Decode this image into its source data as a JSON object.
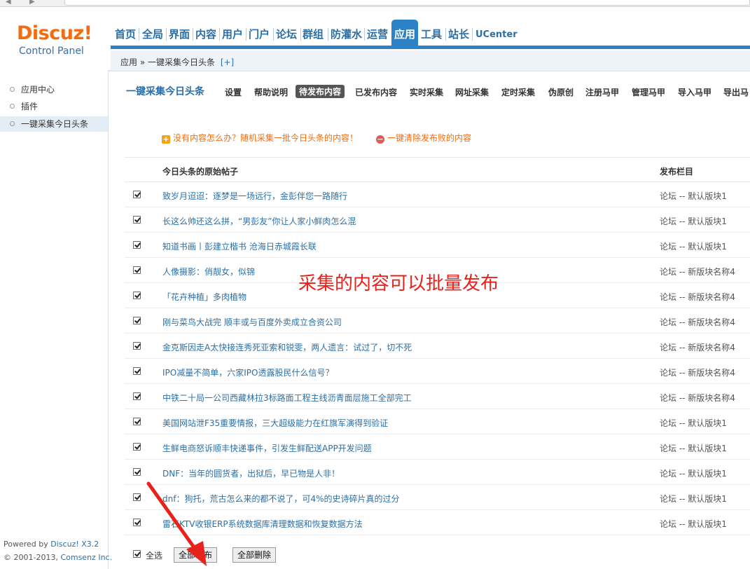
{
  "logo": {
    "main": "Discuz!",
    "sub": "Control Panel"
  },
  "topnav": {
    "items": [
      "首页",
      "全局",
      "界面",
      "内容",
      "用户",
      "门户",
      "论坛",
      "群组",
      "防灌水",
      "运营",
      "应用",
      "工具",
      "站长",
      "UCenter"
    ],
    "active": "应用"
  },
  "breadcrumb": {
    "text": "应用 » 一键采集今日头条",
    "plus": "[+]"
  },
  "sidebar": {
    "items": [
      "应用中心",
      "插件",
      "一键采集今日头条"
    ],
    "footer_powered": "Powered by ",
    "footer_version": "Discuz! X3.2",
    "footer_copy": "© 2001-2013, ",
    "footer_company": "Comsenz Inc."
  },
  "subtabs": {
    "title": "一键采集今日头条",
    "tabs": [
      "设置",
      "帮助说明",
      "待发布内容",
      "已发布内容",
      "实时采集",
      "网址采集",
      "定时采集",
      "伪原创",
      "注册马甲",
      "管理马甲",
      "导入马甲",
      "导出马"
    ],
    "active": "待发布内容"
  },
  "notices": {
    "random": "没有内容怎么办？随机采集一批今日头条的内容！",
    "clear": "一键清除发布败的内容"
  },
  "table": {
    "col_title": "今日头条的原始帖子",
    "col_target": "发布栏目",
    "rows": [
      {
        "title": "致岁月迢迢：逐梦是一场远行，金彭伴您一路随行",
        "target": "论坛 -- 默认版块1",
        "checked": true
      },
      {
        "title": "长这么帅还这么拼，“男彭友”你让人家小鲜肉怎么混",
        "target": "论坛 -- 默认版块1",
        "checked": true
      },
      {
        "title": "知道书画丨彭建立楷书 沧海日赤城霞长联",
        "target": "论坛 -- 默认版块1",
        "checked": true
      },
      {
        "title": "人像摄影：俏靓女，似锦",
        "target": "论坛 -- 新版块名称4",
        "checked": true
      },
      {
        "title": "「花卉种植」多肉植物",
        "target": "论坛 -- 新版块名称4",
        "checked": true
      },
      {
        "title": "刚与菜鸟大战完 顺丰或与百度外卖成立合资公司",
        "target": "论坛 -- 新版块名称4",
        "checked": true
      },
      {
        "title": "金克斯因走A太快接连秀死亚索和锐雯，两人遗言：试过了，切不死",
        "target": "论坛 -- 新版块名称4",
        "checked": true
      },
      {
        "title": "IPO减量不简单，六家IPO透露股民什么信号？",
        "target": "论坛 -- 新版块名称4",
        "checked": true
      },
      {
        "title": "中铁二十局一公司西藏林拉3标路面工程主线沥青面层施工全部完工",
        "target": "论坛 -- 新版块名称4",
        "checked": true
      },
      {
        "title": "美国网站泄F35重要情报，三大超级能力在红旗军演得到验证",
        "target": "论坛 -- 默认版块1",
        "checked": true
      },
      {
        "title": "生鲜电商怒诉顺丰快递事件，引发生鲜配送APP开发问题",
        "target": "论坛 -- 默认版块1",
        "checked": true
      },
      {
        "title": "DNF：当年的圆货者，出狱后，早已物是人非！",
        "target": "论坛 -- 默认版块1",
        "checked": true
      },
      {
        "title": "dnf：狗托，荒古怎么来的都不说了，可4%的史诗碎片真的过分",
        "target": "论坛 -- 默认版块1",
        "checked": true
      },
      {
        "title": "雷石KTV收银ERP系统数据库清理数据和恢复数据方法",
        "target": "论坛 -- 默认版块1",
        "checked": true
      }
    ]
  },
  "footer": {
    "select_all": "全选",
    "publish_all": "全部发布",
    "delete_all": "全部删除"
  },
  "annotation": "采集的内容可以批量发布",
  "colors": {
    "nav_blue": "#2b82c6",
    "link_blue": "#2c6fa6",
    "orange": "#f26c11",
    "annotation_red": "#e8211a"
  }
}
